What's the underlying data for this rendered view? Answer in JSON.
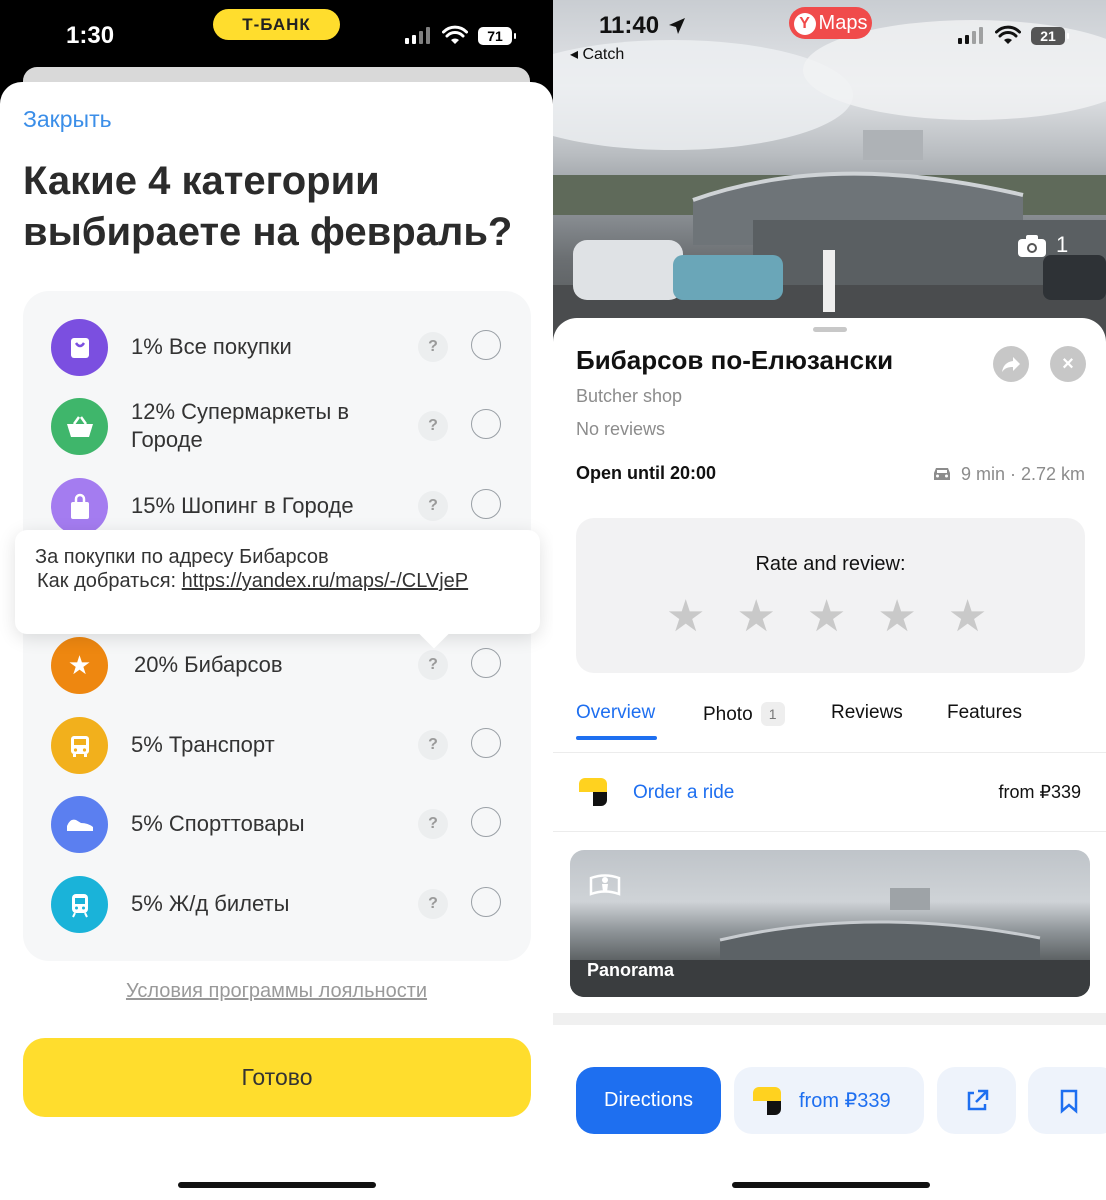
{
  "left_phone": {
    "status": {
      "time": "1:30",
      "bank_badge": "Т-БАНК",
      "battery": "71"
    },
    "close_label": "Закрыть",
    "title": "Какие 4 категории выбираете на февраль?",
    "categories": [
      {
        "label": "1% Все покупки",
        "icon": "shopping-bag-icon",
        "color": "#7b4fe0"
      },
      {
        "label": "12% Супермаркеты в Городе",
        "icon": "basket-icon",
        "color": "#3fb66b"
      },
      {
        "label": "15% Шопинг в Городе",
        "icon": "bag-icon",
        "color": "#a47cf0"
      },
      {
        "label": "20% Бибарсов",
        "icon": "star-icon",
        "color": "#ee8710"
      },
      {
        "label": "5% Транспорт",
        "icon": "bus-icon",
        "color": "#f2b01c"
      },
      {
        "label": "5% Спорттовары",
        "icon": "sneaker-icon",
        "color": "#5b7ff0"
      },
      {
        "label": "5% Ж/д билеты",
        "icon": "train-icon",
        "color": "#1ab3d9"
      }
    ],
    "help_mark": "?",
    "tooltip": {
      "line1": "За покупки по адресу Бибарсов",
      "line2_prefix": "Как добраться: ",
      "link": "https://yandex.ru/maps/-/CLVjeP"
    },
    "loyalty_link": "Условия программы лояльности",
    "done_button": "Готово"
  },
  "right_phone": {
    "status": {
      "time": "11:40",
      "back_app": "◂ Catch",
      "maps_badge": "Maps",
      "battery": "21"
    },
    "photo_count": "1",
    "place_name": "Бибарсов по-Елюзански",
    "category": "Butcher shop",
    "reviews_summary": "No reviews",
    "hours": "Open until 20:00",
    "route_info": "9 min · 2.72 km",
    "rate_title": "Rate and review:",
    "star_count": 5,
    "tabs": [
      {
        "label": "Overview",
        "active": true
      },
      {
        "label": "Photo",
        "badge": "1"
      },
      {
        "label": "Reviews"
      },
      {
        "label": "Features"
      }
    ],
    "order_ride": {
      "label": "Order a ride",
      "price": "from ₽339"
    },
    "panorama_label": "Panorama",
    "actions": {
      "directions": "Directions",
      "taxi_price": "from ₽339"
    },
    "accent_color": "#1e6ff0"
  }
}
